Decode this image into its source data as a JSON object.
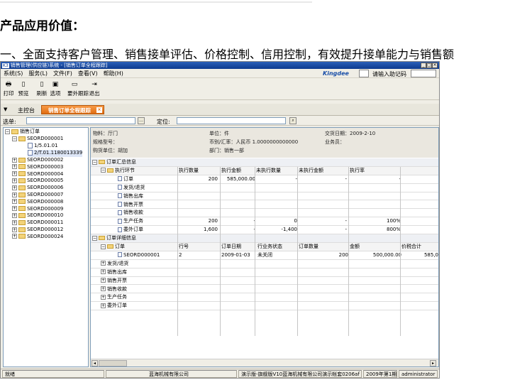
{
  "page": {
    "heading": "产品应用价值：",
    "intro": "一、全面支持客户管理、销售接单评估、价格控制、信用控制，有效提升接单能力与销售额"
  },
  "window": {
    "title_icon": "K3",
    "title": "销售管理(供应链)系统 - [销售订单全程跟踪]",
    "menu": [
      "系统(S)",
      "服务(L)",
      "文件(F)",
      "查看(V)",
      "帮助(H)"
    ],
    "logo": "Kingdee",
    "help_label": "请输入助记码",
    "toolbar": [
      {
        "label": "打印",
        "icon": "printer-icon"
      },
      {
        "label": "预览",
        "icon": "preview-icon"
      },
      {
        "label": "刷新",
        "icon": "refresh-icon"
      },
      {
        "label": "选项",
        "icon": "options-icon"
      },
      {
        "label": "要外跟踪",
        "icon": "track-icon"
      },
      {
        "label": "退出",
        "icon": "exit-icon"
      }
    ],
    "tabs": {
      "home": "主控台",
      "active": "销售订单全程跟踪"
    },
    "select_label": "选单:",
    "locate_label": "定位:"
  },
  "tree": {
    "root": "销售订单",
    "first": "SEORD000001",
    "children": [
      "1/5.01.01",
      "2/T.01.1180013339"
    ],
    "items": [
      "SEORD000002",
      "SEORD000003",
      "SEORD000004",
      "SEORD000005",
      "SEORD000006",
      "SEORD000007",
      "SEORD000008",
      "SEORD000009",
      "SEORD000010",
      "SEORD000011",
      "SEORD000012",
      "SEORD000024"
    ]
  },
  "info": {
    "material": "物料：厅门",
    "spec": "规格型号：",
    "buyer": "购货单位：胡加",
    "unit": "单位：件",
    "currency": "币别/汇率：人民币 1.0000000000000",
    "dept": "部门：销售一部",
    "delivery": "交货日期：2009-2-10",
    "salesman": "业务员："
  },
  "summary": {
    "group": "订单汇总信息",
    "section": "执行环节",
    "columns": [
      "执行数量",
      "执行金额",
      "未执行数量",
      "未执行金额",
      "执行率"
    ],
    "rows": [
      {
        "name": "订单",
        "qty": "200",
        "amt": "585,000.00",
        "unqty": "-",
        "unamt": "-",
        "rate": "-"
      },
      {
        "name": "发货/退货",
        "qty": "",
        "amt": "",
        "unqty": "",
        "unamt": "",
        "rate": ""
      },
      {
        "name": "销售出库",
        "qty": "",
        "amt": "",
        "unqty": "",
        "unamt": "",
        "rate": ""
      },
      {
        "name": "销售开票",
        "qty": "",
        "amt": "",
        "unqty": "",
        "unamt": "",
        "rate": ""
      },
      {
        "name": "销售收款",
        "qty": "",
        "amt": "",
        "unqty": "",
        "unamt": "",
        "rate": ""
      },
      {
        "name": "生产任务",
        "qty": "200",
        "amt": "-",
        "unqty": "0",
        "unamt": "-",
        "rate": "100%"
      },
      {
        "name": "委外订单",
        "qty": "1,600",
        "amt": "-",
        "unqty": "-1,400",
        "unamt": "-",
        "rate": "800%"
      }
    ]
  },
  "detail": {
    "group": "订单详细信息",
    "section": "订单",
    "columns": [
      "行号",
      "订单日期",
      "行业务状态",
      "订单数量",
      "金额",
      "价税合计"
    ],
    "row": {
      "no": "SEORD000001",
      "line": "2",
      "date": "2009-01-03",
      "status": "未关闭",
      "qty": "200",
      "amt": "500,000.00",
      "total": "585,0"
    },
    "others": [
      "发货/退货",
      "销售出库",
      "销售开票",
      "销售收款",
      "生产任务",
      "委外订单"
    ]
  },
  "status": [
    "就绪",
    "蓝海机械有限公司",
    "演示版-旗舰版V10蓝海机械有限公司演示帐套0206af",
    "2009年第1期",
    "administrator"
  ]
}
